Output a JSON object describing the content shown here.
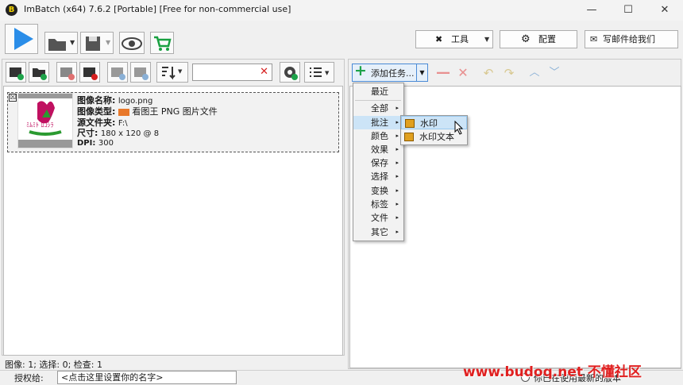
{
  "window": {
    "title": "ImBatch (x64) 7.6.2 [Portable] [Free for non-commercial use]",
    "app_icon_glyph": "B",
    "controls": [
      "—",
      "☐",
      "✕"
    ]
  },
  "toolbar": {
    "tools_label": "工具",
    "config_label": "配置",
    "email_label": "写邮件给我们",
    "icons": [
      "run-icon",
      "open-folder-icon",
      "save-icon",
      "preview-icon",
      "cart-icon"
    ]
  },
  "left_toolbar": {
    "search_value": "",
    "icons": [
      "add-image-icon",
      "add-folder-icon",
      "remove-image-icon",
      "remove-all-icon",
      "move-up-icon",
      "info-icon",
      "sort-icon",
      "settings-check-icon",
      "view-list-icon"
    ]
  },
  "image_item": {
    "name_label": "图像名称:",
    "name_value": "logo.png",
    "type_label": "图像类型:",
    "type_value": "看图王 PNG 图片文件",
    "folder_label": "源文件夹:",
    "folder_value": "F:\\",
    "size_label": "尺寸:",
    "size_value": "180 x 120 @ 8",
    "dpi_label": "DPI:",
    "dpi_value": "300",
    "checkbox_glyph": "☒"
  },
  "status": {
    "text": "图像: 1; 选择: 0; 检查: 1"
  },
  "task_panel": {
    "add_task_label": "添加任务..."
  },
  "menu": {
    "items": [
      {
        "label": "最近",
        "arrow": ""
      },
      {
        "label": "全部",
        "arrow": "▸"
      },
      {
        "label": "批注",
        "arrow": "▸"
      },
      {
        "label": "颜色",
        "arrow": "▸"
      },
      {
        "label": "效果",
        "arrow": "▸"
      },
      {
        "label": "保存",
        "arrow": "▸"
      },
      {
        "label": "选择",
        "arrow": "▸"
      },
      {
        "label": "变换",
        "arrow": "▸"
      },
      {
        "label": "标签",
        "arrow": "▸"
      },
      {
        "label": "文件",
        "arrow": "▸"
      },
      {
        "label": "其它",
        "arrow": "▸"
      }
    ],
    "submenu": [
      {
        "label": "水印"
      },
      {
        "label": "水印文本"
      }
    ]
  },
  "bottom": {
    "license_label": "授权给:",
    "license_placeholder": "<点击这里设置你的名字>",
    "update_text": "你已在使用最新的版本"
  },
  "watermark": "www.budoq.net 不懂社区"
}
